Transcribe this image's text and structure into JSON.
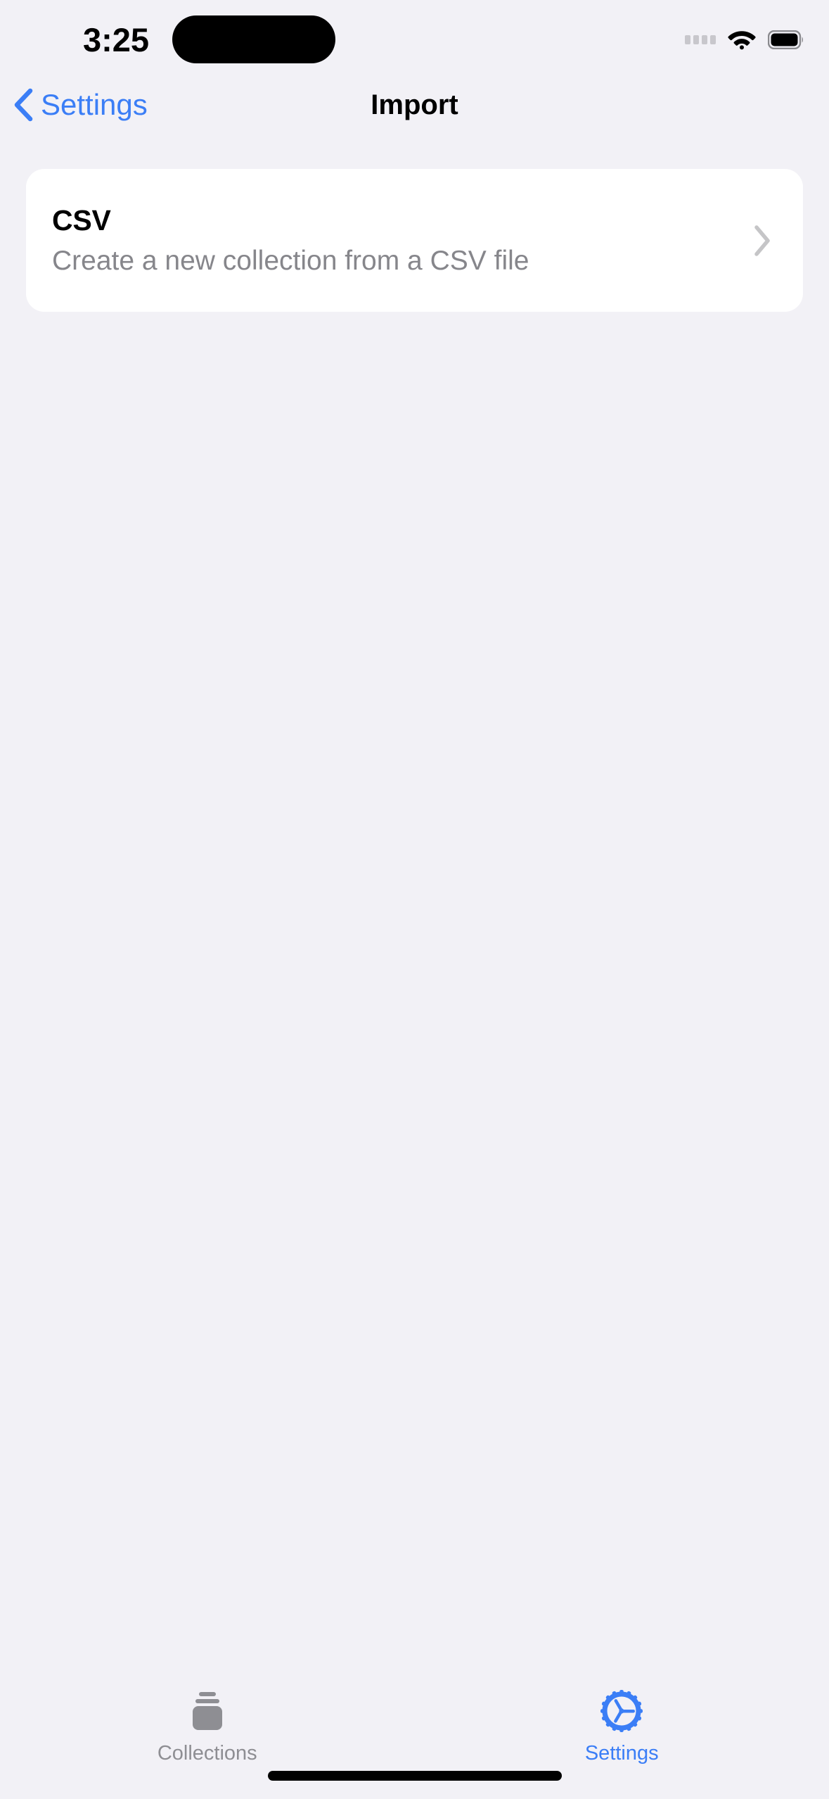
{
  "status_bar": {
    "time": "3:25",
    "cellular_icon": "cellular-dots-icon",
    "wifi_icon": "wifi-icon",
    "battery_icon": "battery-icon",
    "dynamic_island": "dynamic-island"
  },
  "nav_bar": {
    "back_label": "Settings",
    "back_icon": "chevron-left-icon",
    "title": "Import"
  },
  "main": {
    "rows": [
      {
        "title": "CSV",
        "subtitle": "Create a new collection from a CSV file",
        "accessory_icon": "chevron-right-icon"
      }
    ]
  },
  "tab_bar": {
    "items": [
      {
        "label": "Collections",
        "icon": "square-stack-icon",
        "active": false
      },
      {
        "label": "Settings",
        "icon": "gear-icon",
        "active": true
      }
    ]
  },
  "colors": {
    "background": "#f2f1f6",
    "card": "#ffffff",
    "accent": "#3b7ef6",
    "secondary_text": "#86868b",
    "inactive_tab": "#8e8e93",
    "chevron": "#c5c5c7"
  }
}
